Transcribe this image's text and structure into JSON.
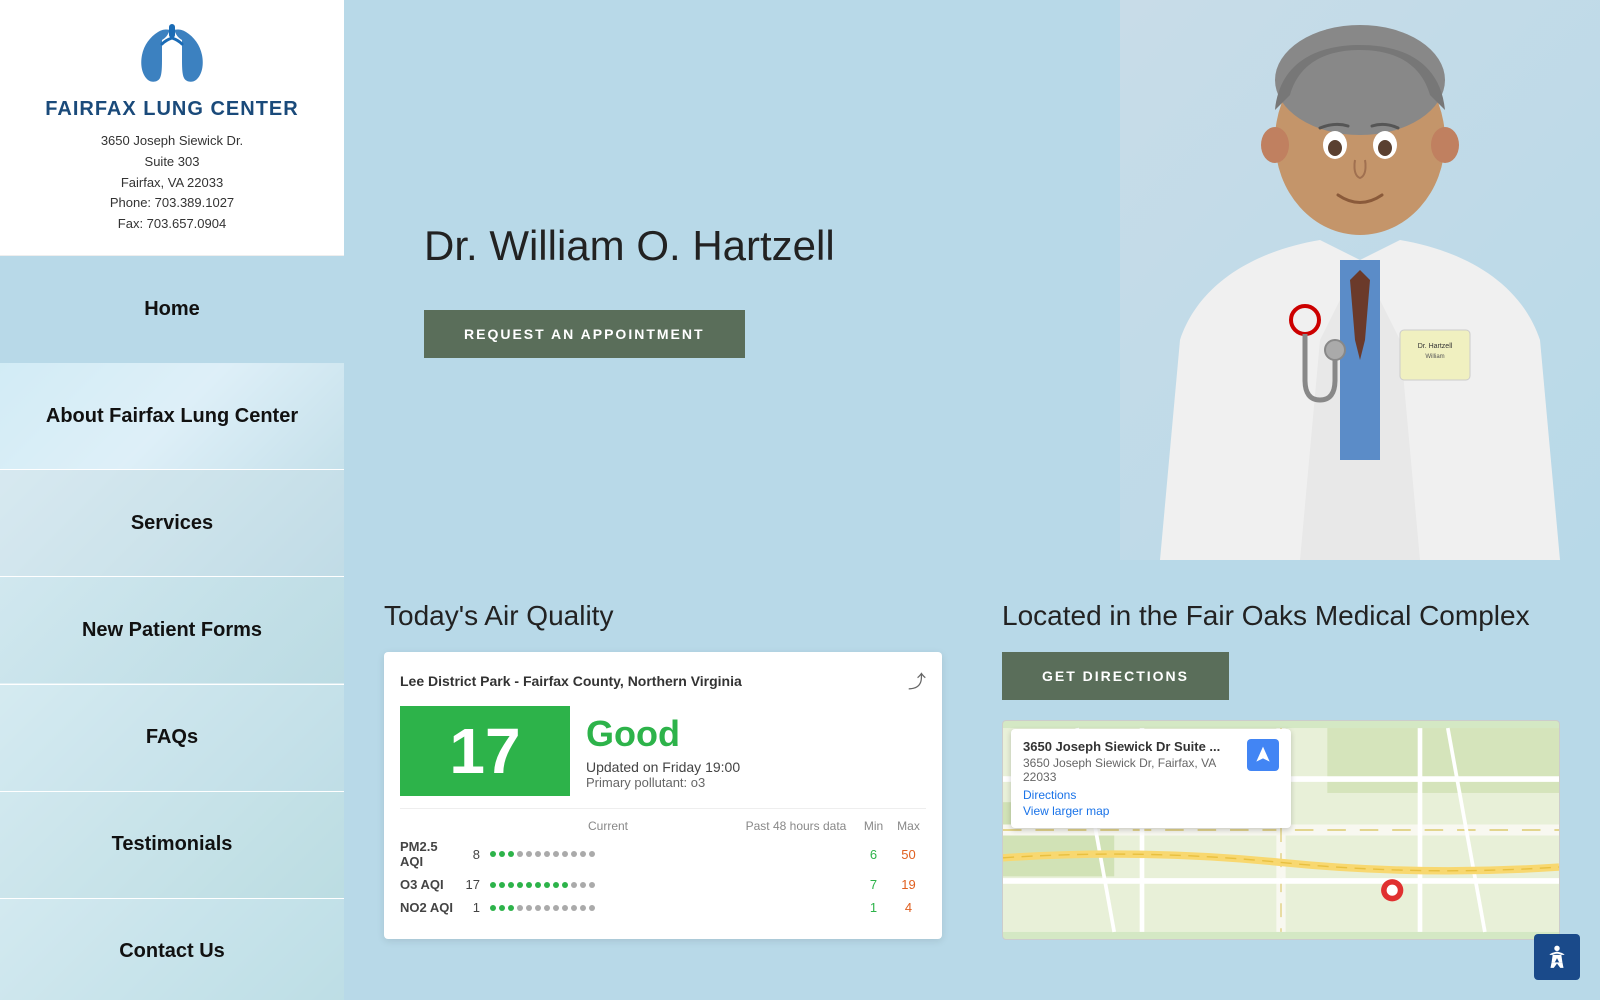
{
  "clinic": {
    "name": "FAIRFAX LUNG CENTER",
    "address_line1": "3650 Joseph Siewick Dr.",
    "address_line2": "Suite 303",
    "city_state_zip": "Fairfax, VA 22033",
    "phone": "Phone: 703.389.1027",
    "fax": "Fax: 703.657.0904"
  },
  "nav": {
    "items": [
      {
        "id": "home",
        "label": "Home",
        "active": true
      },
      {
        "id": "about",
        "label": "About Fairfax Lung Center",
        "active": false
      },
      {
        "id": "services",
        "label": "Services",
        "active": false
      },
      {
        "id": "new-patient",
        "label": "New Patient Forms",
        "active": false
      },
      {
        "id": "faqs",
        "label": "FAQs",
        "active": false
      },
      {
        "id": "testimonials",
        "label": "Testimonials",
        "active": false
      },
      {
        "id": "contact",
        "label": "Contact Us",
        "active": false
      }
    ]
  },
  "hero": {
    "doctor_name": "Dr. William O. Hartzell",
    "appointment_button": "REQUEST AN APPOINTMENT"
  },
  "air_quality": {
    "section_title": "Today's Air Quality",
    "station": "Lee District Park - Fairfax County, Northern Virginia",
    "aqi_value": "17",
    "aqi_status": "Good",
    "updated": "Updated on Friday 19:00",
    "primary_pollutant": "Primary pollutant: o3",
    "rows": [
      {
        "label": "PM2.5 AQI",
        "value": "8",
        "min": "6",
        "max": "50",
        "pct": 16,
        "dot_count": 12,
        "green_dots": 4
      },
      {
        "label": "O3 AQI",
        "value": "17",
        "min": "7",
        "max": "19",
        "pct": 80,
        "dot_count": 12,
        "green_dots": 9
      },
      {
        "label": "NO2 AQI",
        "value": "1",
        "min": "1",
        "max": "4",
        "pct": 25,
        "dot_count": 12,
        "green_dots": 3
      }
    ]
  },
  "location": {
    "section_title": "Located in the Fair Oaks Medical Complex",
    "directions_button": "GET DIRECTIONS",
    "map_info": {
      "title": "3650 Joseph Siewick Dr Suite ...",
      "address": "3650 Joseph Siewick Dr, Fairfax, VA 22033",
      "directions_link": "Directions",
      "view_larger": "View larger map"
    }
  }
}
